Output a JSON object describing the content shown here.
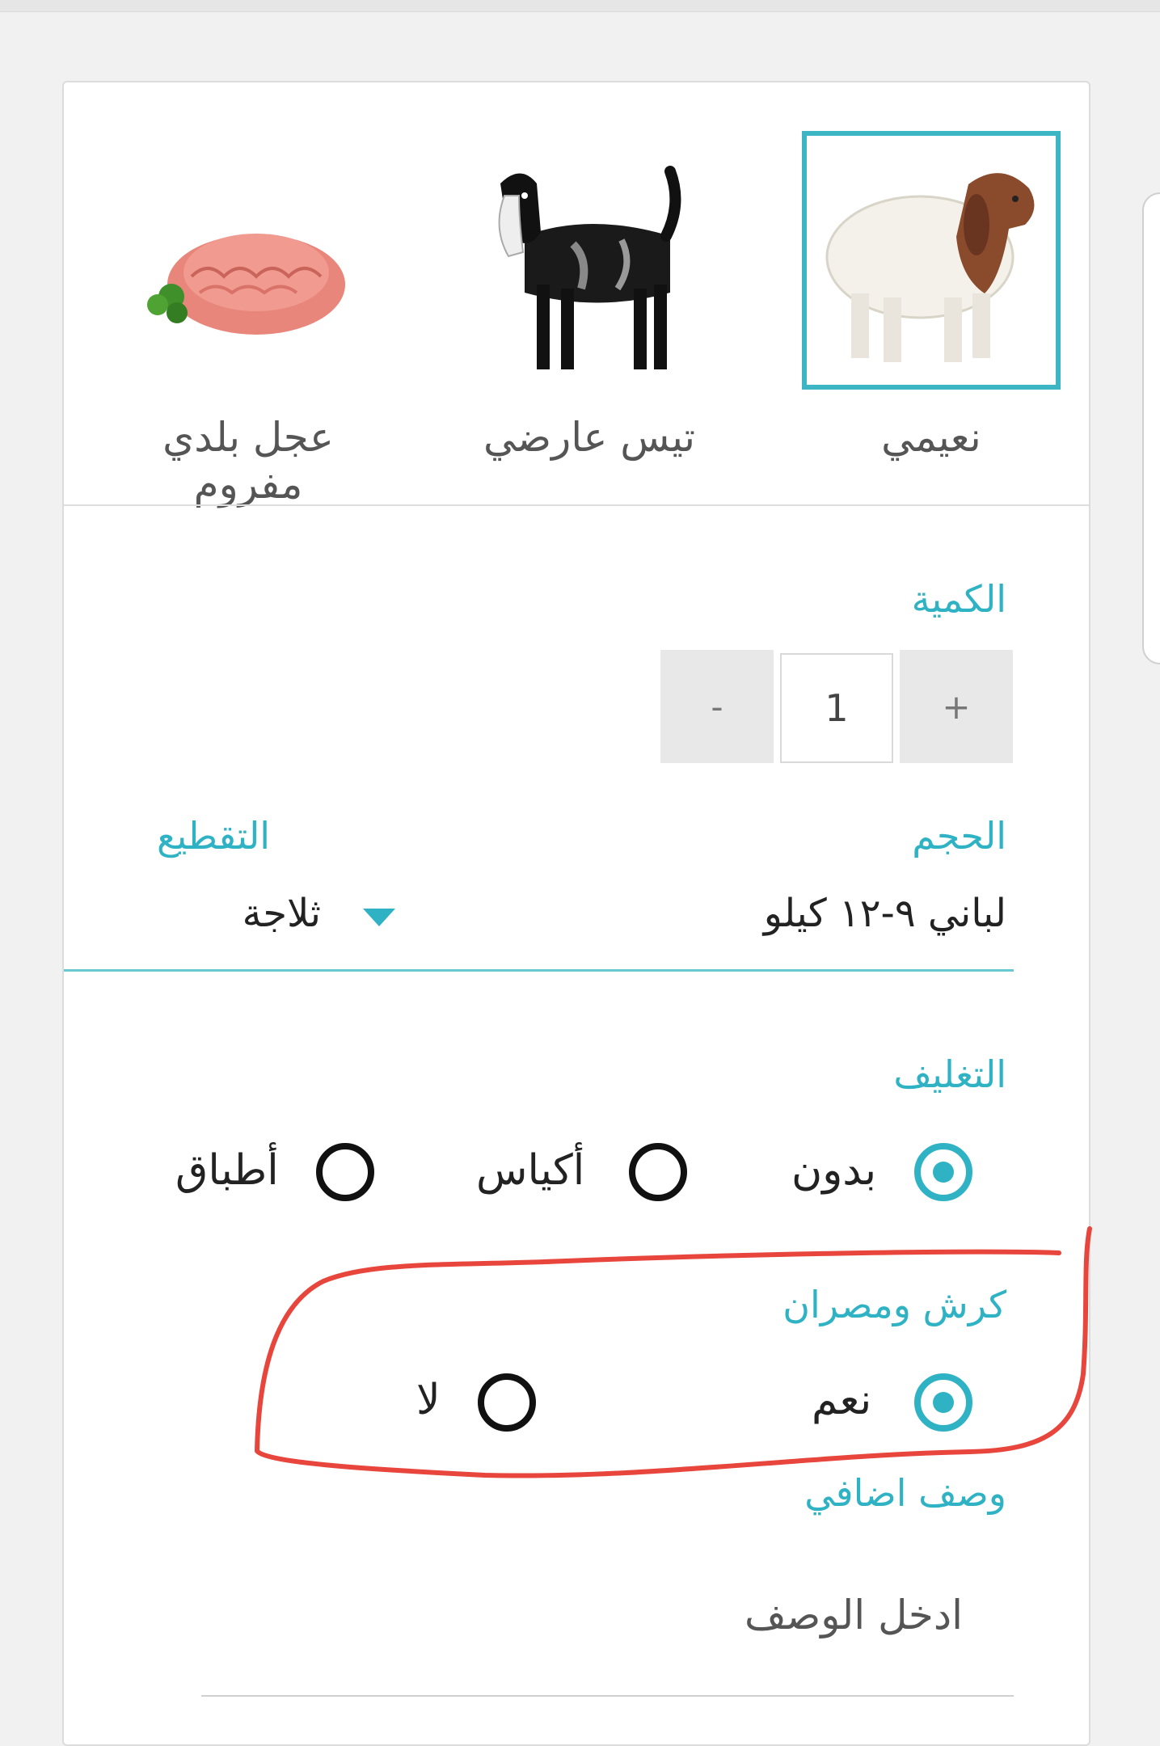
{
  "products": [
    {
      "name": "نعيمي",
      "selected": true
    },
    {
      "name": "تيس عارضي",
      "selected": false
    },
    {
      "name": "عجل بلدي مفروم",
      "selected": false
    }
  ],
  "quantity": {
    "label": "الكمية",
    "plus": "+",
    "value": "1",
    "minus": "-"
  },
  "size": {
    "label": "الحجم",
    "value": "لباني ٩-١٢ كيلو"
  },
  "cutting": {
    "label": "التقطيع",
    "value": "ثلاجة"
  },
  "packaging": {
    "label": "التغليف",
    "options": [
      {
        "label": "بدون",
        "checked": true
      },
      {
        "label": "أكياس",
        "checked": false
      },
      {
        "label": "أطباق",
        "checked": false
      }
    ]
  },
  "offal": {
    "label": "كرش ومصران",
    "options": [
      {
        "label": "نعم",
        "checked": true
      },
      {
        "label": "لا",
        "checked": false
      }
    ]
  },
  "extra_description": {
    "label": "وصف اضافي",
    "placeholder": "ادخل الوصف"
  },
  "colors": {
    "accent": "#2fb3c4",
    "annotation": "#e8453c"
  }
}
